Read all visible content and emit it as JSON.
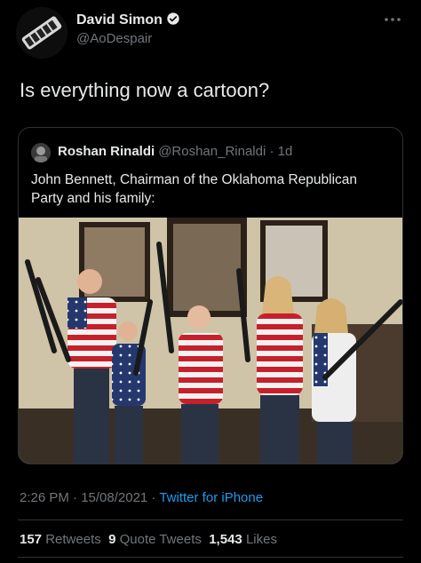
{
  "author": {
    "display_name": "David Simon",
    "handle": "@AoDespair"
  },
  "tweet": {
    "text": "Is everything now a cartoon?"
  },
  "quoted_tweet": {
    "display_name": "Roshan Rinaldi",
    "handle_time": "@Roshan_Rinaldi · 1d",
    "text": "John Bennett, Chairman of the Oklahoma Republican Party and his family:"
  },
  "meta": {
    "timestamp": "2:26 PM · 15/08/2021 ·",
    "source": "Twitter for iPhone"
  },
  "stats": {
    "retweets_count": "157",
    "retweets_label": "Retweets",
    "quote_count": "9",
    "quote_label": "Quote Tweets",
    "likes_count": "1,543",
    "likes_label": "Likes"
  },
  "icons": {
    "verified": "verified-badge-icon",
    "more": "more-options-icon"
  },
  "colors": {
    "background": "#000000",
    "text": "#e7e9ea",
    "secondary": "#71767b",
    "link": "#1d9bf0",
    "border": "#2f3336"
  }
}
